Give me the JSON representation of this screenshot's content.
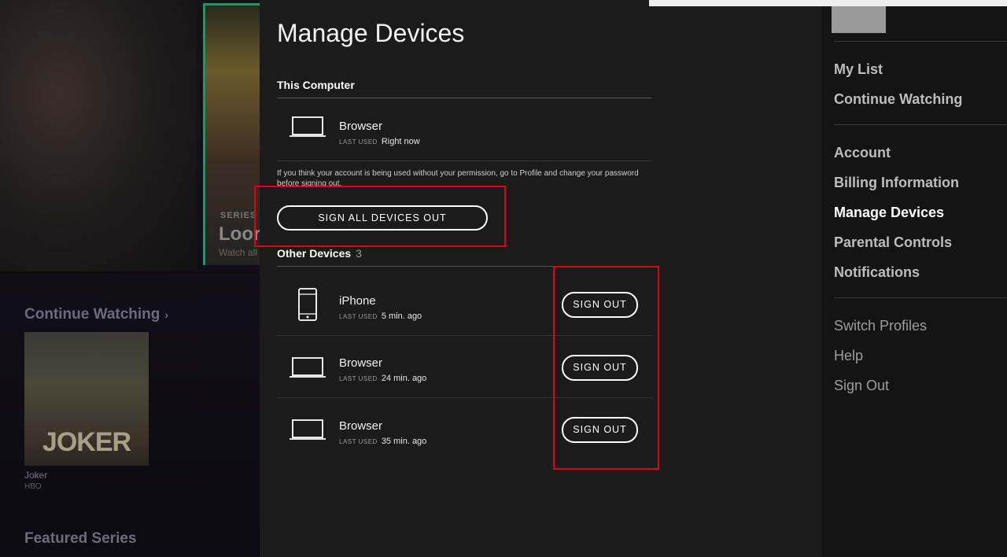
{
  "background": {
    "hero_tag": "SERIES",
    "hero_title": "Loor",
    "hero_subtitle": "Watch all",
    "continue_watching_title": "Continue Watching",
    "continue_watching_chevron": "›",
    "poster_word": "JOKER",
    "poster_title": "Joker",
    "poster_network": "HBO",
    "featured_title": "Featured Series"
  },
  "panel": {
    "title": "Manage Devices",
    "this_computer": {
      "heading": "This Computer",
      "device": {
        "icon": "laptop-icon",
        "name": "Browser",
        "last_used_label": "LAST USED",
        "last_used": "Right now"
      }
    },
    "warning": "If you think your account is being used without your permission, go to Profile and change your password before signing out.",
    "sign_all_out_label": "SIGN ALL DEVICES OUT",
    "other_devices": {
      "heading": "Other Devices",
      "count": "3",
      "devices": [
        {
          "icon": "phone-icon",
          "name": "iPhone",
          "last_used_label": "LAST USED",
          "last_used": "5 min. ago",
          "sign_out_label": "SIGN OUT"
        },
        {
          "icon": "laptop-icon",
          "name": "Browser",
          "last_used_label": "LAST USED",
          "last_used": "24 min. ago",
          "sign_out_label": "SIGN OUT"
        },
        {
          "icon": "laptop-icon",
          "name": "Browser",
          "last_used_label": "LAST USED",
          "last_used": "35 min. ago",
          "sign_out_label": "SIGN OUT"
        }
      ]
    }
  },
  "sidebar": {
    "group1": [
      "My List",
      "Continue Watching"
    ],
    "group2": [
      "Account",
      "Billing Information",
      "Manage Devices",
      "Parental Controls",
      "Notifications"
    ],
    "active_item": "Manage Devices",
    "group3": [
      "Switch Profiles",
      "Help",
      "Sign Out"
    ]
  },
  "colors": {
    "panel_bg": "#1b1b1b",
    "highlight": "#e1000f",
    "text": "#ffffff"
  }
}
